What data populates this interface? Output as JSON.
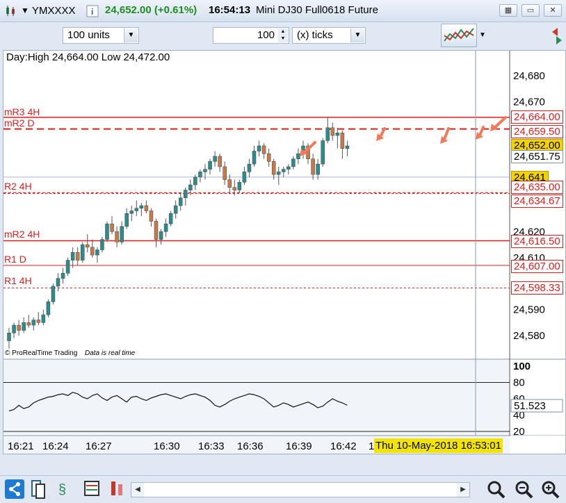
{
  "titlebar": {
    "symbol": "YMXXXX",
    "price": "24,652.00 (+0.61%)",
    "time": "16:54:13",
    "instrument": "Mini DJ30 Full0618 Future"
  },
  "toolbar": {
    "units": "100 units",
    "ticks_value": "100",
    "ticks_unit": "(x) ticks"
  },
  "chart": {
    "header": "Day:High 24,664.00 Low 24,472.00",
    "copyright": "© ProRealTime Trading",
    "realtime": "Data is real time",
    "date_label": "Thu 10-May-2018 16:53:01",
    "x_labels": [
      "16:21",
      "16:24",
      "16:27",
      "16:30",
      "16:33",
      "16:36",
      "16:39",
      "16:42",
      "1"
    ],
    "y_labels": [
      "24,680",
      "24,670",
      "24,620",
      "24,610",
      "24,590",
      "24,580"
    ],
    "levels": [
      {
        "name": "mR3 4H",
        "value": "24,664.00"
      },
      {
        "name": "mR2 D",
        "value": "24,659.50"
      },
      {
        "name": "",
        "value": "24,652.00"
      },
      {
        "name": "",
        "value": "24,651.75"
      },
      {
        "name": "",
        "value": "24,641"
      },
      {
        "name": "R2 4H",
        "value": "24,635.00"
      },
      {
        "name": "",
        "value": "24,634.67"
      },
      {
        "name": "mR2 4H",
        "value": "24,616.50"
      },
      {
        "name": "R1 D",
        "value": "24,607.00"
      },
      {
        "name": "R1 4H",
        "value": "24,598.33"
      }
    ],
    "indicator_labels": [
      "100",
      "80",
      "60",
      "40",
      "20"
    ],
    "indicator_value": "51.523"
  },
  "chart_data": {
    "type": "candlestick",
    "y_unit": "price",
    "ylim": [
      24575,
      24685
    ],
    "candles_ohlc": [
      [
        24578,
        24583,
        24575,
        24581
      ],
      [
        24581,
        24585,
        24579,
        24584
      ],
      [
        24584,
        24586,
        24580,
        24582
      ],
      [
        24582,
        24587,
        24581,
        24585
      ],
      [
        24585,
        24588,
        24583,
        24584
      ],
      [
        24584,
        24587,
        24582,
        24586
      ],
      [
        24586,
        24589,
        24584,
        24585
      ],
      [
        24585,
        24590,
        24584,
        24588
      ],
      [
        24588,
        24594,
        24587,
        24593
      ],
      [
        24593,
        24600,
        24592,
        24599
      ],
      [
        24599,
        24604,
        24597,
        24602
      ],
      [
        24602,
        24606,
        24600,
        24604
      ],
      [
        24604,
        24610,
        24603,
        24609
      ],
      [
        24609,
        24614,
        24606,
        24612
      ],
      [
        24612,
        24614,
        24607,
        24609
      ],
      [
        24609,
        24616,
        24608,
        24615
      ],
      [
        24615,
        24619,
        24612,
        24614
      ],
      [
        24614,
        24617,
        24610,
        24611
      ],
      [
        24611,
        24614,
        24608,
        24613
      ],
      [
        24613,
        24618,
        24612,
        24617
      ],
      [
        24617,
        24624,
        24616,
        24623
      ],
      [
        24623,
        24626,
        24619,
        24620
      ],
      [
        24620,
        24622,
        24614,
        24616
      ],
      [
        24616,
        24624,
        24615,
        24622
      ],
      [
        24622,
        24629,
        24621,
        24627
      ],
      [
        24627,
        24630,
        24624,
        24628
      ],
      [
        24628,
        24632,
        24626,
        24629
      ],
      [
        24629,
        24631,
        24626,
        24630
      ],
      [
        24630,
        24632,
        24627,
        24628
      ],
      [
        24628,
        24629,
        24622,
        24624
      ],
      [
        24624,
        24625,
        24614,
        24617
      ],
      [
        24617,
        24621,
        24615,
        24620
      ],
      [
        24620,
        24625,
        24618,
        24623
      ],
      [
        24623,
        24628,
        24622,
        24627
      ],
      [
        24627,
        24632,
        24625,
        24630
      ],
      [
        24630,
        24635,
        24628,
        24633
      ],
      [
        24633,
        24637,
        24630,
        24636
      ],
      [
        24636,
        24640,
        24634,
        24638
      ],
      [
        24638,
        24642,
        24636,
        24641
      ],
      [
        24641,
        24644,
        24639,
        24643
      ],
      [
        24643,
        24646,
        24640,
        24644
      ],
      [
        24644,
        24648,
        24642,
        24647
      ],
      [
        24647,
        24651,
        24645,
        24649
      ],
      [
        24649,
        24650,
        24643,
        24645
      ],
      [
        24645,
        24647,
        24638,
        24640
      ],
      [
        24640,
        24642,
        24635,
        24637
      ],
      [
        24637,
        24640,
        24634,
        24636
      ],
      [
        24636,
        24640,
        24635,
        24639
      ],
      [
        24639,
        24645,
        24638,
        24643
      ],
      [
        24643,
        24648,
        24641,
        24646
      ],
      [
        24646,
        24653,
        24645,
        24651
      ],
      [
        24651,
        24655,
        24649,
        24653
      ],
      [
        24653,
        24654,
        24648,
        24650
      ],
      [
        24650,
        24652,
        24645,
        24647
      ],
      [
        24647,
        24648,
        24640,
        24642
      ],
      [
        24642,
        24645,
        24638,
        24643
      ],
      [
        24643,
        24645,
        24641,
        24644
      ],
      [
        24644,
        24646,
        24642,
        24645
      ],
      [
        24645,
        24649,
        24644,
        24648
      ],
      [
        24648,
        24652,
        24646,
        24650
      ],
      [
        24650,
        24655,
        24648,
        24653
      ],
      [
        24653,
        24654,
        24646,
        24648
      ],
      [
        24648,
        24650,
        24640,
        24642
      ],
      [
        24642,
        24648,
        24640,
        24646
      ],
      [
        24646,
        24656,
        24645,
        24655
      ],
      [
        24655,
        24664,
        24654,
        24660
      ],
      [
        24660,
        24662,
        24655,
        24657
      ],
      [
        24657,
        24660,
        24652,
        24658
      ],
      [
        24658,
        24659,
        24648,
        24652
      ],
      [
        24652,
        24655,
        24649,
        24653
      ]
    ],
    "indicator": [
      45,
      47,
      52,
      48,
      50,
      55,
      58,
      60,
      62,
      63,
      65,
      66,
      64,
      68,
      66,
      62,
      60,
      64,
      66,
      61,
      58,
      62,
      64,
      60,
      56,
      62,
      63,
      60,
      58,
      61,
      63,
      65,
      66,
      64,
      62,
      60,
      63,
      65,
      66,
      64,
      62,
      58,
      52,
      50,
      53,
      57,
      60,
      62,
      64,
      66,
      65,
      63,
      60,
      55,
      50,
      52,
      55,
      53,
      50,
      52,
      54,
      56,
      53,
      49,
      51,
      56,
      60,
      57,
      55,
      52
    ],
    "arrows": 5
  },
  "colors": {
    "bullish": "#2e8b8b",
    "bearish": "#c47a4a",
    "level_red": "#e21b1b",
    "arrow": "#f07a5a",
    "price_box": "#f2d200",
    "level_blue": "#a9b8d6"
  }
}
